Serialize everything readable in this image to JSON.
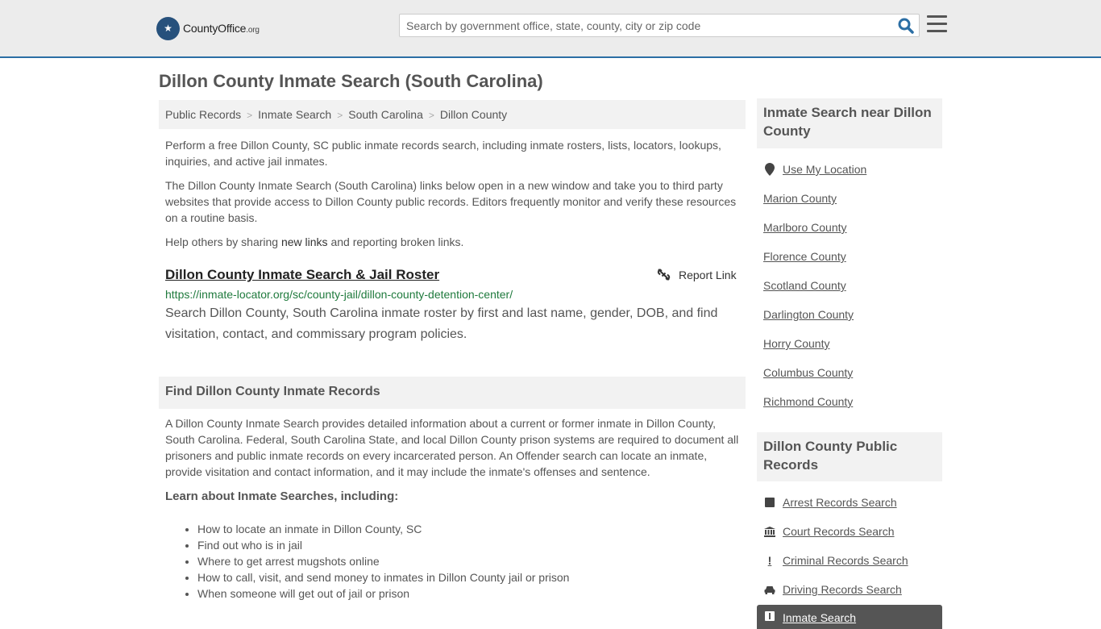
{
  "header": {
    "logo_text": "CountyOffice",
    "logo_tld": ".org",
    "search_placeholder": "Search by government office, state, county, city or zip code"
  },
  "page": {
    "title": "Dillon County Inmate Search (South Carolina)"
  },
  "breadcrumb": [
    "Public Records",
    "Inmate Search",
    "South Carolina",
    "Dillon County"
  ],
  "intro": {
    "p1": "Perform a free Dillon County, SC public inmate records search, including inmate rosters, lists, locators, lookups, inquiries, and active jail inmates.",
    "p2": "The Dillon County Inmate Search (South Carolina) links below open in a new window and take you to third party websites that provide access to Dillon County public records. Editors frequently monitor and verify these resources on a routine basis.",
    "p3_before": "Help others by sharing ",
    "p3_link": "new links",
    "p3_after": " and reporting broken links."
  },
  "result": {
    "title": "Dillon County Inmate Search & Jail Roster",
    "report_label": "Report Link",
    "url": "https://inmate-locator.org/sc/county-jail/dillon-county-detention-center/",
    "description": "Search Dillon County, South Carolina inmate roster by first and last name, gender, DOB, and find visitation, contact, and commissary program policies."
  },
  "find_section": {
    "heading": "Find Dillon County Inmate Records",
    "body": "A Dillon County Inmate Search provides detailed information about a current or former inmate in Dillon County, South Carolina. Federal, South Carolina State, and local Dillon County prison systems are required to document all prisoners and public inmate records on every incarcerated person. An Offender search can locate an inmate, provide visitation and contact information, and it may include the inmate's offenses and sentence.",
    "learn_heading": "Learn about Inmate Searches, including:",
    "bullets": [
      "How to locate an inmate in Dillon County, SC",
      "Find out who is in jail",
      "Where to get arrest mugshots online",
      "How to call, visit, and send money to inmates in Dillon County jail or prison",
      "When someone will get out of jail or prison"
    ]
  },
  "sidebar": {
    "near_heading": "Inmate Search near Dillon County",
    "use_location": "Use My Location",
    "nearby": [
      "Marion County",
      "Marlboro County",
      "Florence County",
      "Scotland County",
      "Darlington County",
      "Horry County",
      "Columbus County",
      "Richmond County"
    ],
    "records_heading": "Dillon County Public Records",
    "records": [
      "Arrest Records Search",
      "Court Records Search",
      "Criminal Records Search",
      "Driving Records Search"
    ],
    "active_item": "Inmate Search"
  }
}
